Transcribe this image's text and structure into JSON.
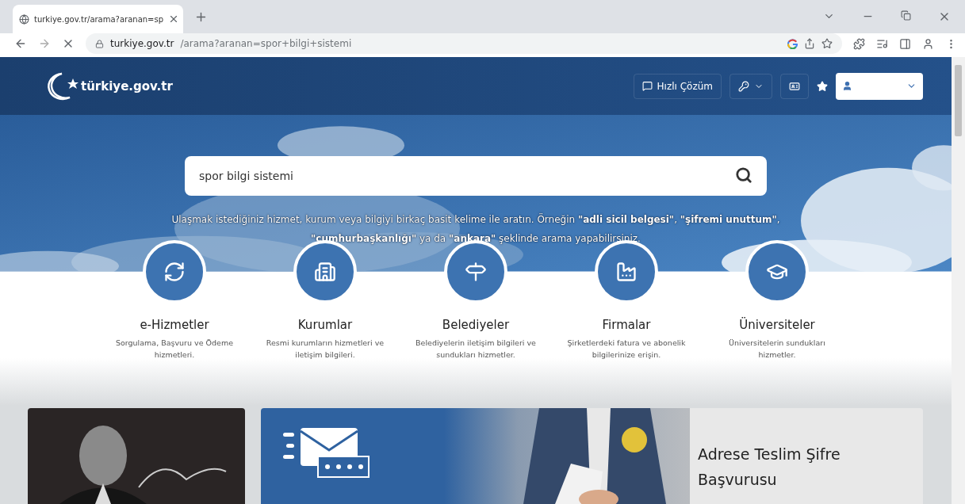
{
  "browser": {
    "tab": {
      "title": "turkiye.gov.tr/arama?aranan=sp",
      "selected": true
    },
    "address": {
      "host": "turkiye.gov.tr",
      "path": "/arama?aranan=spor+bilgi+sistemi"
    }
  },
  "header": {
    "logo": "türkiye.gov.tr",
    "quick_help": "Hızlı Çözüm"
  },
  "search": {
    "value": "spor bilgi sistemi",
    "hint": "Ulaşmak istediğiniz hizmet, kurum veya bilgiyi birkaç basit kelime ile aratın. Örneğin **\"adli sicil belgesi\"**, **\"şifremi unuttum\"**, **\"cumhurbaşkanlığı\"** ya da **\"ankara\"** şeklinde arama yapabilirsiniz."
  },
  "categories": [
    {
      "kind": "services",
      "title": "e-Hizmetler",
      "description": "Sorgulama, Başvuru ve Ödeme hizmetleri."
    },
    {
      "kind": "institutions",
      "title": "Kurumlar",
      "description": "Resmi kurumların hizmetleri ve iletişim bilgileri."
    },
    {
      "kind": "municipalities",
      "title": "Belediyeler",
      "description": "Belediyelerin iletişim bilgileri ve sundukları hizmetler."
    },
    {
      "kind": "companies",
      "title": "Firmalar",
      "description": "Şirketlerdeki fatura ve abonelik bilgilerinize erişin."
    },
    {
      "kind": "universities",
      "title": "Üniversiteler",
      "description": "Üniversitelerin sundukları hizmetler."
    }
  ],
  "promo": {
    "title": "Adrese Teslim Şifre Başvurusu"
  }
}
